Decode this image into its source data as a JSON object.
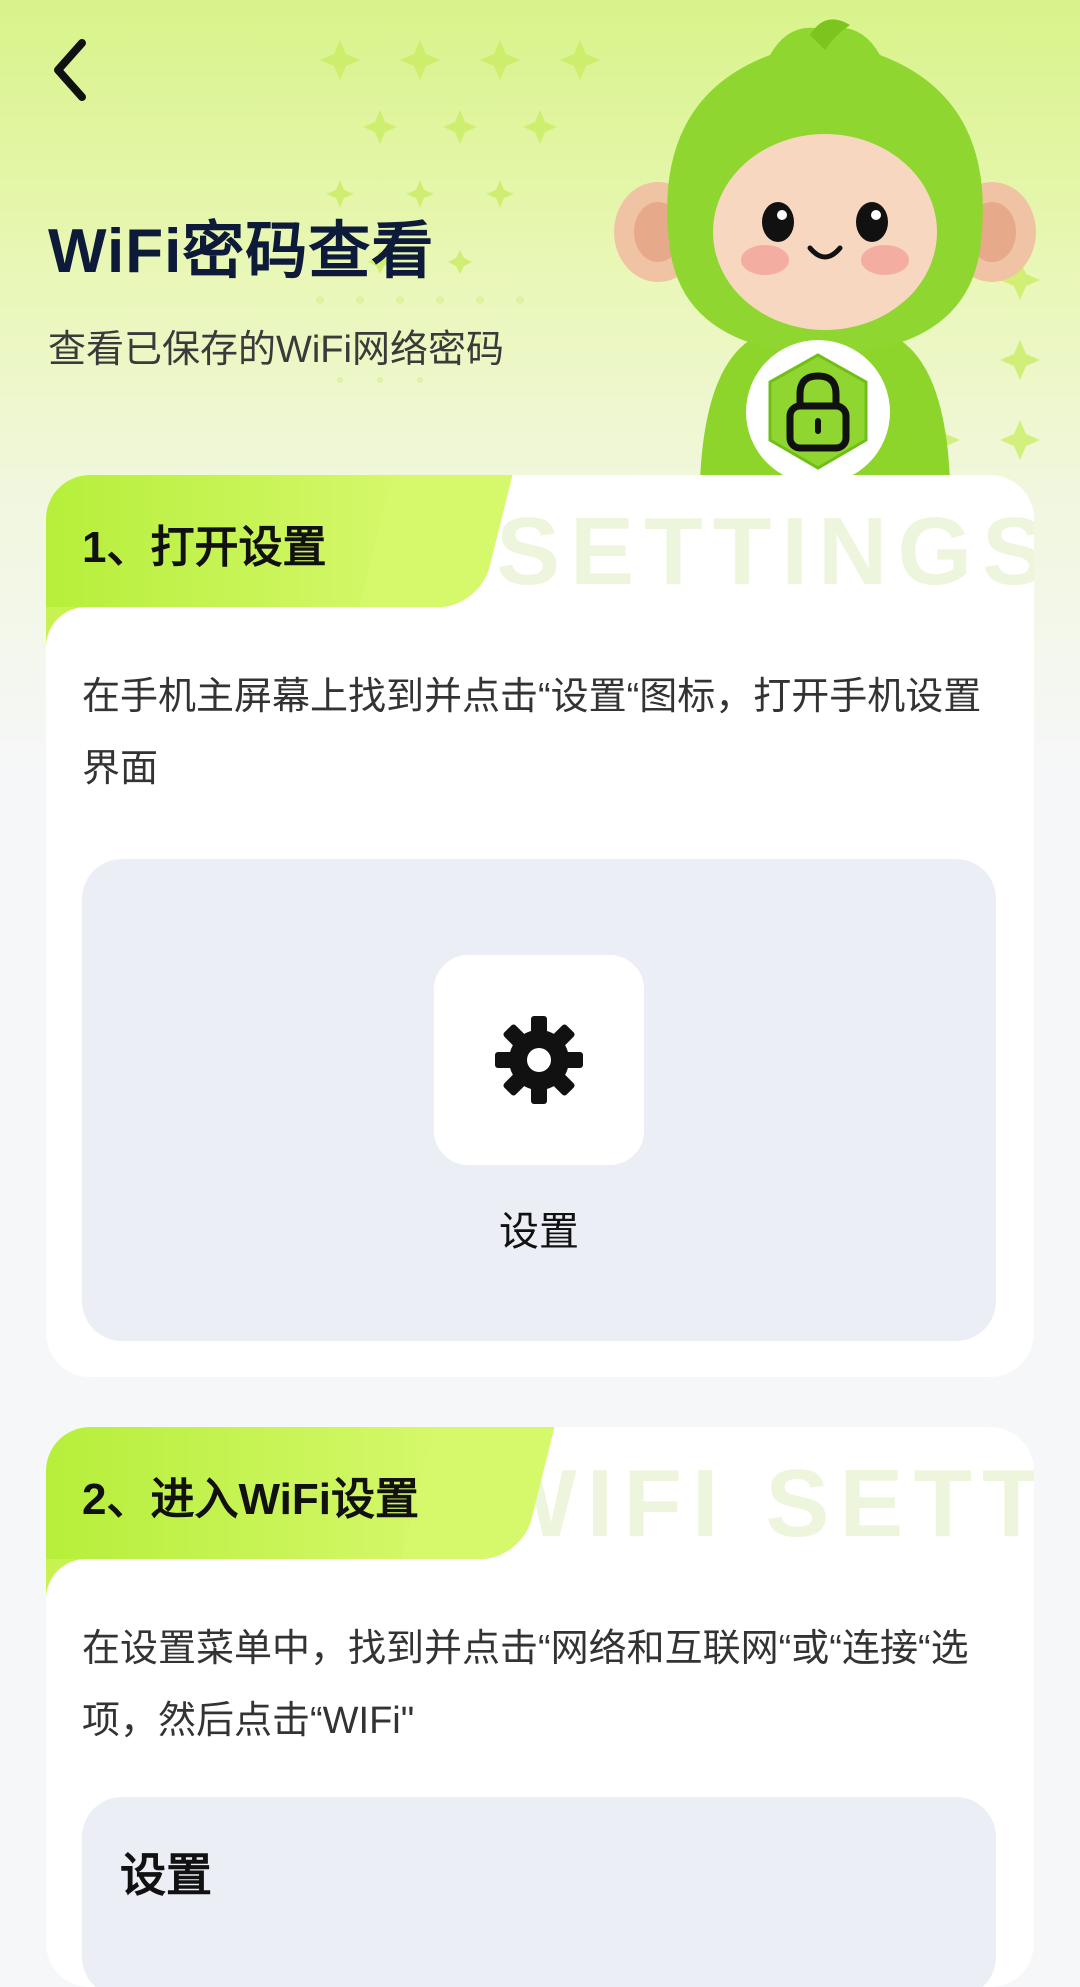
{
  "header": {
    "title": "WiFi密码查看",
    "subtitle": "查看已保存的WiFi网络密码"
  },
  "steps": [
    {
      "label": "1、打开设置",
      "watermark": "SETTINGS",
      "description": "在手机主屏幕上找到并点击“设置“图标，打开手机设置界面",
      "demo": {
        "app_label": "设置"
      }
    },
    {
      "label": "2、进入WiFi设置",
      "watermark": "WIFI SETT",
      "description": "在设置菜单中，找到并点击“网络和互联网“或“连接“选项，然后点击“WIFi\"",
      "demo": {
        "heading": "设置"
      }
    }
  ],
  "icons": {
    "back": "chevron-left-icon",
    "lock": "lock-icon",
    "settings": "gear-icon"
  },
  "colors": {
    "accent": "#b6ef3b",
    "title": "#0d1a3a",
    "demo_bg": "#ebeef5"
  }
}
